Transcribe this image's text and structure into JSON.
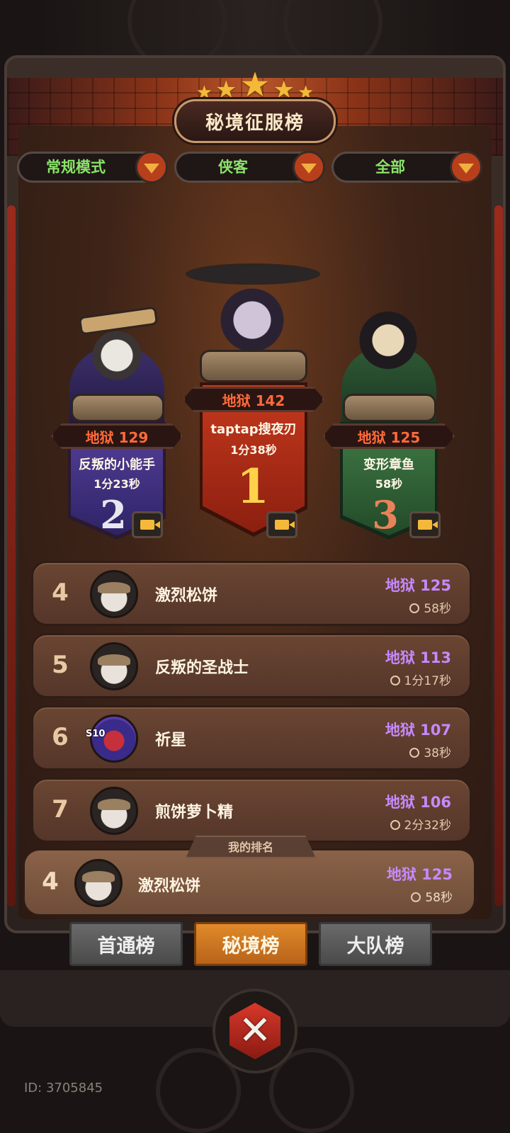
{
  "title": "秘境征服榜",
  "filters": [
    {
      "label": "常规模式"
    },
    {
      "label": "侠客"
    },
    {
      "label": "全部"
    }
  ],
  "podium": {
    "first": {
      "rank": "1",
      "level": "地狱 142",
      "name": "taptap搜夜刃",
      "time": "1分38秒"
    },
    "second": {
      "rank": "2",
      "level": "地狱 129",
      "name": "反叛的小能手",
      "time": "1分23秒"
    },
    "third": {
      "rank": "3",
      "level": "地狱 125",
      "name": "变形章鱼",
      "time": "58秒"
    }
  },
  "rows": [
    {
      "rank": "4",
      "name": "激烈松饼",
      "level": "地狱 125",
      "time": "58秒"
    },
    {
      "rank": "5",
      "name": "反叛的圣战士",
      "level": "地狱 113",
      "time": "1分17秒"
    },
    {
      "rank": "6",
      "name": "祈星",
      "level": "地狱 107",
      "time": "38秒",
      "badge": "S10"
    },
    {
      "rank": "7",
      "name": "煎饼萝卜精",
      "level": "地狱 106",
      "time": "2分32秒"
    }
  ],
  "my_rank": {
    "tag": "我的排名",
    "rank": "4",
    "name": "激烈松饼",
    "level": "地狱 125",
    "time": "58秒"
  },
  "tabs": [
    {
      "label": "首通榜",
      "active": false
    },
    {
      "label": "秘境榜",
      "active": true
    },
    {
      "label": "大队榜",
      "active": false
    }
  ],
  "footer": {
    "id_text": "ID: 3705845"
  },
  "colors": {
    "accent_gold": "#f5b93a",
    "level_purple": "#c58aff",
    "rank_red": "#ff6a3a",
    "filter_green": "#8be36a",
    "tab_active": "#e08a2a"
  }
}
